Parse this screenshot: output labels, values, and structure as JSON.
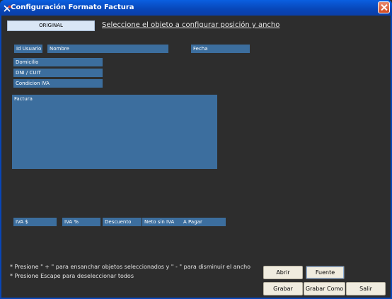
{
  "window": {
    "title": "Configuración Formato Factura"
  },
  "header": {
    "original_label": "ORIGINAL",
    "instruction": "Seleccione el objeto a configurar posición y ancho"
  },
  "fields": {
    "id_usuario": "Id Usuario",
    "nombre": "Nombre",
    "fecha": "Fecha",
    "domicilio": "Domicilio",
    "dni_cuit": "DNI / CUIT",
    "condicion_iva": "Condicion IVA",
    "factura": "Factura",
    "iva_pesos": "IVA $",
    "iva_pct": "IVA %",
    "descuento": "Descuento",
    "neto_sin_iva": "Neto sin IVA",
    "a_pagar": "A Pagar"
  },
  "notes": {
    "line1": "* Presione \" + \" para ensanchar objetos seleccionados y \" - \" para disminuir el ancho",
    "line2": "* Presione Escape para deseleccionar todos"
  },
  "buttons": {
    "abrir": "Abrir",
    "fuente": "Fuente",
    "grabar": "Grabar",
    "grabar_como": "Grabar Como",
    "salir": "Salir"
  },
  "colors": {
    "field_bg": "#3c6e9e",
    "client_bg": "#2d2d2d",
    "titlebar": "#0846b8"
  }
}
